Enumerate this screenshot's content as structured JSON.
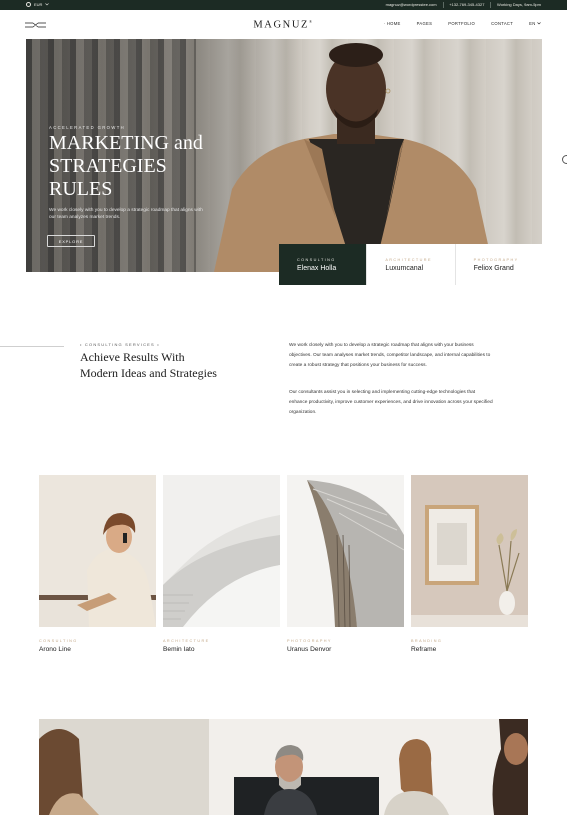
{
  "topbar": {
    "language": "EUR",
    "email": "magnuz@wordpresstee.com",
    "phone": "+132-769-345-4327",
    "hours": "Working Days, 9am-5pm"
  },
  "header": {
    "logo": "MAGNUZ",
    "logo_mark": "®",
    "nav": [
      "HOME",
      "PAGES",
      "PORTFOLIO",
      "CONTACT",
      "EN"
    ]
  },
  "hero": {
    "eyebrow": "ACCELERATED GROWTH",
    "title_lines": [
      "MARKETING and",
      "STRATEGIES",
      "RULES"
    ],
    "text": "We work closely with you to develop a strategic roadmap that aligns with our team analyzes market trends.",
    "button": "EXPLORE",
    "cards": [
      {
        "category": "CONSULTING",
        "name": "Elenax Holla"
      },
      {
        "category": "ARCHITECTURE",
        "name": "Luxumcanal"
      },
      {
        "category": "PHOTOGRAPHY",
        "name": "Feliox Grand"
      }
    ]
  },
  "about": {
    "eyebrow": "CONSULTING SERVICES",
    "title_lines": [
      "Achieve Results With",
      "Modern Ideas and Strategies"
    ],
    "paragraph1": "We work closely with you to develop a strategic roadmap that aligns with your business objectives. Our team analyses market trends, competitor landscape, and internal capabilities to create a robust strategy that positions your business for success.",
    "paragraph2": "Our consultants assist you in selecting and implementing cutting-edge technologies that enhance productivity, improve customer experiences, and drive innovation across your specified organization."
  },
  "projects": [
    {
      "category": "CONSULTING",
      "name": "Arono Line"
    },
    {
      "category": "ARCHITECTURE",
      "name": "Bemin Iato"
    },
    {
      "category": "PHOTOGRAPHY",
      "name": "Uranus Denvor"
    },
    {
      "category": "BRANDING",
      "name": "Reframe"
    }
  ],
  "colors": {
    "dark_green": "#1c2b24",
    "accent_tan": "#c3a888"
  }
}
